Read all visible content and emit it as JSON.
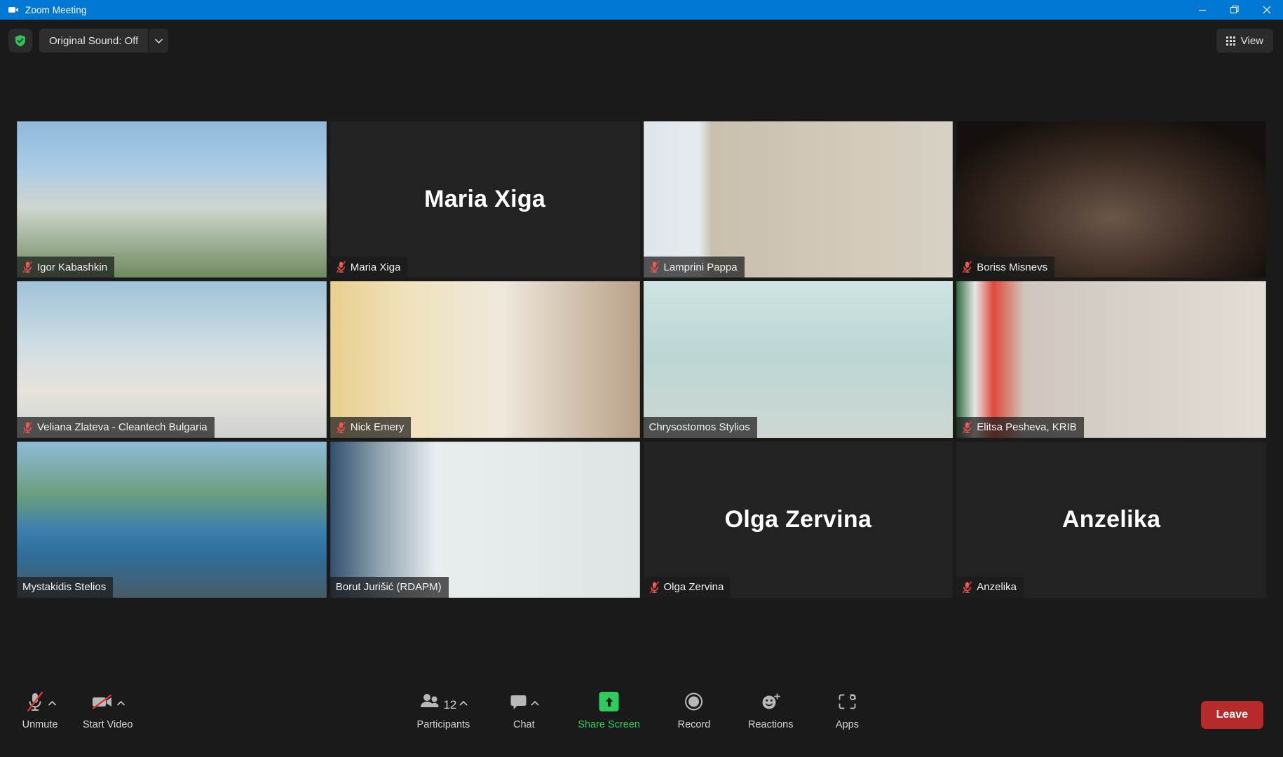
{
  "window": {
    "title": "Zoom Meeting",
    "app_icon": "video-camera-icon",
    "minimize_label": "Minimize",
    "restore_label": "Restore",
    "close_label": "Close",
    "titlebar_color": "#0078d4"
  },
  "topbar": {
    "security_icon": "shield-check-icon",
    "original_sound_label": "Original Sound: Off",
    "original_sound_caret": "chevron-down-icon",
    "view_label": "View",
    "view_icon": "grid-icon"
  },
  "stage": {
    "active_speaker_border_color": "#cce861",
    "tile_background": "#222222",
    "tiles": [
      {
        "name": "Igor Kabashkin",
        "muted": true,
        "video": true,
        "speaking": false,
        "scene": "office-building"
      },
      {
        "name": "Maria Xiga",
        "muted": true,
        "video": false,
        "speaking": false,
        "scene": "placeholder"
      },
      {
        "name": "Lamprini Pappa",
        "muted": true,
        "video": true,
        "speaking": false,
        "scene": "binders-shelf"
      },
      {
        "name": "Boriss Misnevs",
        "muted": true,
        "video": true,
        "speaking": false,
        "scene": "dark-interior"
      },
      {
        "name": "Veliana Zlateva - Cleantech Bulgaria",
        "muted": true,
        "video": true,
        "speaking": false,
        "scene": "blue-blur"
      },
      {
        "name": "Nick Emery",
        "muted": true,
        "video": true,
        "speaking": false,
        "scene": "warm-room"
      },
      {
        "name": "Chrysostomos Stylios",
        "muted": false,
        "video": true,
        "speaking": true,
        "scene": "teal-room"
      },
      {
        "name": "Elitsa Pesheva, KRIB",
        "muted": true,
        "video": true,
        "speaking": false,
        "scene": "flag-room"
      },
      {
        "name": "Mystakidis Stelios",
        "muted": false,
        "video": true,
        "speaking": false,
        "scene": "seaside"
      },
      {
        "name": "Borut Jurišić (RDAPM)",
        "muted": false,
        "video": true,
        "speaking": false,
        "scene": "lab-room"
      },
      {
        "name": "Olga Zervina",
        "muted": true,
        "video": false,
        "speaking": false,
        "scene": "placeholder"
      },
      {
        "name": "Anzelika",
        "muted": true,
        "video": false,
        "speaking": false,
        "scene": "placeholder"
      }
    ]
  },
  "toolbar": {
    "mute": {
      "label": "Unmute",
      "icon": "microphone-muted-icon",
      "caret": "chevron-up-icon"
    },
    "video": {
      "label": "Start Video",
      "icon": "camera-off-icon",
      "caret": "chevron-up-icon"
    },
    "participants": {
      "label": "Participants",
      "icon": "people-icon",
      "count": "12",
      "caret": "chevron-up-icon"
    },
    "chat": {
      "label": "Chat",
      "icon": "speech-bubble-icon",
      "caret": "chevron-up-icon"
    },
    "share_screen": {
      "label": "Share Screen",
      "icon": "share-arrow-up-icon",
      "accent": "#2ecc5f"
    },
    "record": {
      "label": "Record",
      "icon": "record-circle-icon"
    },
    "reactions": {
      "label": "Reactions",
      "icon": "smiley-plus-icon"
    },
    "apps": {
      "label": "Apps",
      "icon": "apps-icon"
    },
    "leave": {
      "label": "Leave",
      "color": "#b72a2a"
    }
  }
}
